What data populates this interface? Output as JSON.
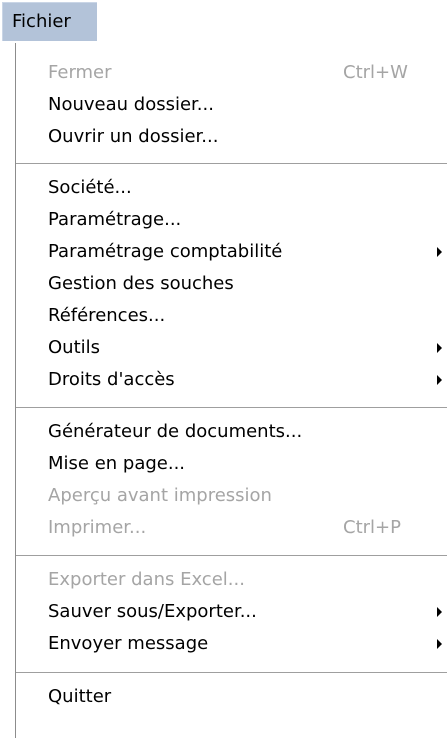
{
  "menubar": {
    "title": "Fichier"
  },
  "menu": {
    "items": [
      {
        "label": "Fermer",
        "shortcut": "Ctrl+W",
        "disabled": true,
        "submenu": false
      },
      {
        "label": "Nouveau dossier...",
        "shortcut": "",
        "disabled": false,
        "submenu": false
      },
      {
        "label": "Ouvrir un dossier...",
        "shortcut": "",
        "disabled": false,
        "submenu": false
      },
      {
        "label": "Société...",
        "shortcut": "",
        "disabled": false,
        "submenu": false
      },
      {
        "label": "Paramétrage...",
        "shortcut": "",
        "disabled": false,
        "submenu": false
      },
      {
        "label": "Paramétrage comptabilité",
        "shortcut": "",
        "disabled": false,
        "submenu": true
      },
      {
        "label": "Gestion des souches",
        "shortcut": "",
        "disabled": false,
        "submenu": false
      },
      {
        "label": "Références...",
        "shortcut": "",
        "disabled": false,
        "submenu": false
      },
      {
        "label": "Outils",
        "shortcut": "",
        "disabled": false,
        "submenu": true
      },
      {
        "label": "Droits d'accès",
        "shortcut": "",
        "disabled": false,
        "submenu": true
      },
      {
        "label": "Générateur de documents...",
        "shortcut": "",
        "disabled": false,
        "submenu": false
      },
      {
        "label": "Mise en page...",
        "shortcut": "",
        "disabled": false,
        "submenu": false
      },
      {
        "label": "Aperçu avant impression",
        "shortcut": "",
        "disabled": true,
        "submenu": false
      },
      {
        "label": "Imprimer...",
        "shortcut": "Ctrl+P",
        "disabled": true,
        "submenu": false
      },
      {
        "label": "Exporter dans Excel...",
        "shortcut": "",
        "disabled": true,
        "submenu": false
      },
      {
        "label": "Sauver sous/Exporter...",
        "shortcut": "",
        "disabled": false,
        "submenu": true
      },
      {
        "label": "Envoyer message",
        "shortcut": "",
        "disabled": false,
        "submenu": true
      },
      {
        "label": "Quitter",
        "shortcut": "",
        "disabled": false,
        "submenu": false
      }
    ]
  },
  "colors": {
    "tab_background": "#b3c3d9",
    "disabled_text": "#a5a5a5",
    "separator": "#9f9f9f"
  }
}
